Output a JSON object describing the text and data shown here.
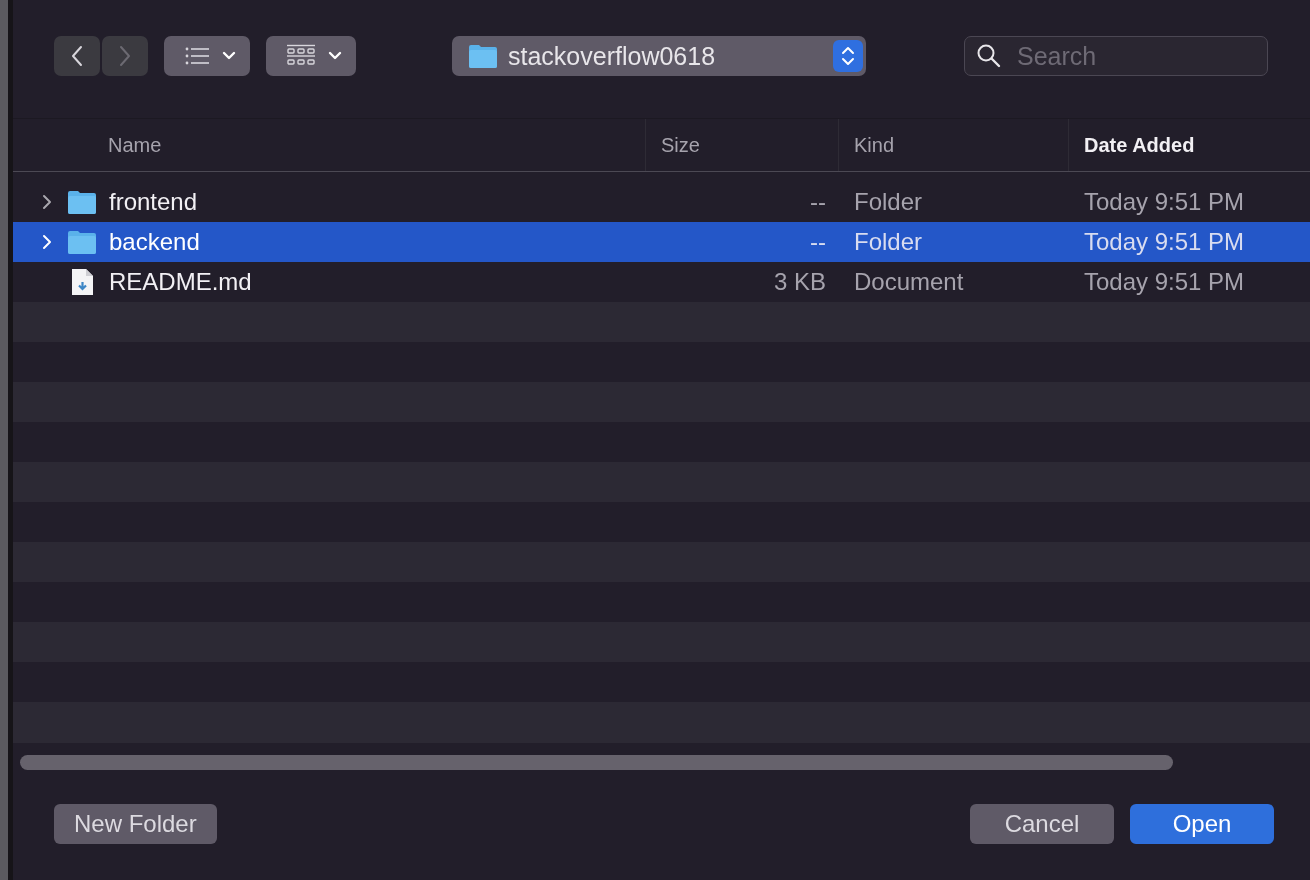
{
  "toolbar": {
    "location": "stackoverflow0618",
    "search": {
      "placeholder": "Search"
    }
  },
  "table": {
    "columns": [
      {
        "label": "Name",
        "sorted": false
      },
      {
        "label": "Size",
        "sorted": false
      },
      {
        "label": "Kind",
        "sorted": false
      },
      {
        "label": "Date Added",
        "sorted": true
      }
    ],
    "rows": [
      {
        "kind": "folder",
        "name": "frontend",
        "size": "--",
        "type": "Folder",
        "date": "Today 9:51 PM",
        "selected": false,
        "expanded": false
      },
      {
        "kind": "folder",
        "name": "backend",
        "size": "--",
        "type": "Folder",
        "date": "Today 9:51 PM",
        "selected": true,
        "expanded": false
      },
      {
        "kind": "document",
        "name": "README.md",
        "size": "3 KB",
        "type": "Document",
        "date": "Today 9:51 PM",
        "selected": false
      }
    ]
  },
  "buttons": {
    "new_folder": "New Folder",
    "cancel": "Cancel",
    "open": "Open"
  }
}
